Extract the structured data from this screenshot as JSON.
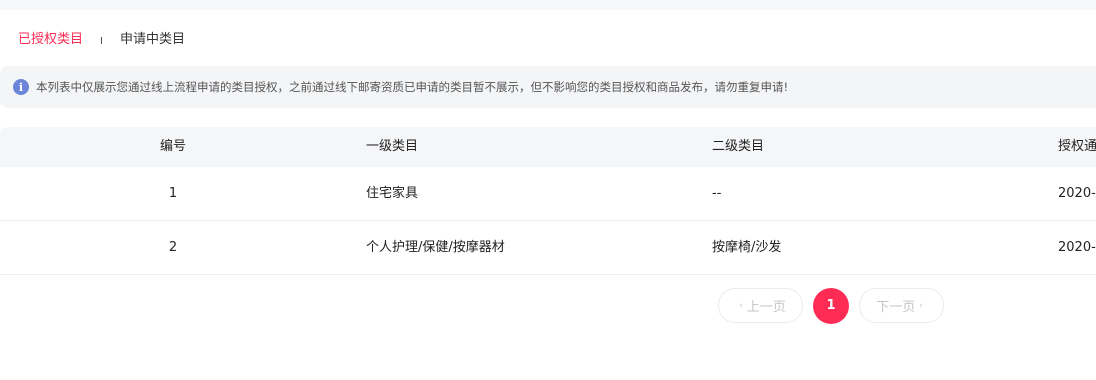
{
  "tabs": {
    "authorized_label": "已授权类目",
    "applying_label": "申请中类目"
  },
  "notice": {
    "icon": "info-icon",
    "icon_glyph": "i",
    "text": "本列表中仅展示您通过线上流程申请的类目授权，之前通过线下邮寄资质已申请的类目暂不展示，但不影响您的类目授权和商品发布，请勿重复申请!"
  },
  "table": {
    "headers": {
      "id": "编号",
      "level1": "一级类目",
      "level2": "二级类目",
      "date": "授权通"
    },
    "rows": [
      {
        "id": "1",
        "level1": "住宅家具",
        "level2": "--",
        "date": "2020-"
      },
      {
        "id": "2",
        "level1": "个人护理/保健/按摩器材",
        "level2": "按摩椅/沙发",
        "date": "2020-"
      }
    ]
  },
  "pagination": {
    "prev_label": "上一页",
    "next_label": "下一页",
    "current_page": "1",
    "prev_icon": "‹",
    "next_icon": "›"
  },
  "colors": {
    "accent": "#fe2c55",
    "info": "#6b86d8",
    "header_bg": "#f5f6f8"
  }
}
